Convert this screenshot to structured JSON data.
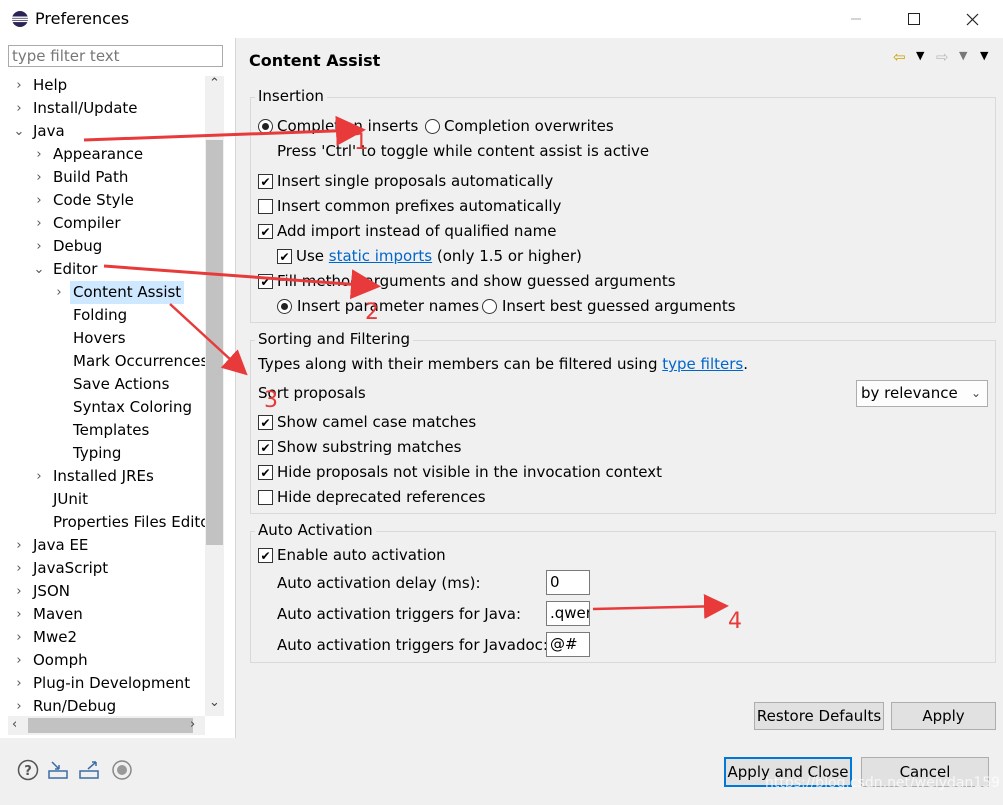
{
  "window": {
    "title": "Preferences"
  },
  "filter": {
    "placeholder": "type filter text"
  },
  "tree": {
    "items": [
      {
        "label": "Help",
        "level": 0,
        "chev": "›"
      },
      {
        "label": "Install/Update",
        "level": 0,
        "chev": "›"
      },
      {
        "label": "Java",
        "level": 0,
        "chev": "⌄"
      },
      {
        "label": "Appearance",
        "level": 1,
        "chev": "›"
      },
      {
        "label": "Build Path",
        "level": 1,
        "chev": "›"
      },
      {
        "label": "Code Style",
        "level": 1,
        "chev": "›"
      },
      {
        "label": "Compiler",
        "level": 1,
        "chev": "›"
      },
      {
        "label": "Debug",
        "level": 1,
        "chev": "›"
      },
      {
        "label": "Editor",
        "level": 1,
        "chev": "⌄"
      },
      {
        "label": "Content Assist",
        "level": 2,
        "chev": "›",
        "selected": true
      },
      {
        "label": "Folding",
        "level": 2,
        "chev": ""
      },
      {
        "label": "Hovers",
        "level": 2,
        "chev": ""
      },
      {
        "label": "Mark Occurrences",
        "level": 2,
        "chev": ""
      },
      {
        "label": "Save Actions",
        "level": 2,
        "chev": ""
      },
      {
        "label": "Syntax Coloring",
        "level": 2,
        "chev": ""
      },
      {
        "label": "Templates",
        "level": 2,
        "chev": ""
      },
      {
        "label": "Typing",
        "level": 2,
        "chev": ""
      },
      {
        "label": "Installed JREs",
        "level": 1,
        "chev": "›"
      },
      {
        "label": "JUnit",
        "level": 1,
        "chev": ""
      },
      {
        "label": "Properties Files Edito",
        "level": 1,
        "chev": ""
      },
      {
        "label": "Java EE",
        "level": 0,
        "chev": "›"
      },
      {
        "label": "JavaScript",
        "level": 0,
        "chev": "›"
      },
      {
        "label": "JSON",
        "level": 0,
        "chev": "›"
      },
      {
        "label": "Maven",
        "level": 0,
        "chev": "›"
      },
      {
        "label": "Mwe2",
        "level": 0,
        "chev": "›"
      },
      {
        "label": "Oomph",
        "level": 0,
        "chev": "›"
      },
      {
        "label": "Plug-in Development",
        "level": 0,
        "chev": "›"
      },
      {
        "label": "Run/Debug",
        "level": 0,
        "chev": "›"
      }
    ]
  },
  "page": {
    "title": "Content Assist"
  },
  "insertion": {
    "group_label": "Insertion",
    "completion_inserts": "Completion inserts",
    "completion_overwrites": "Completion overwrites",
    "toggle_hint": "Press 'Ctrl' to toggle while content assist is active",
    "insert_single": "Insert single proposals automatically",
    "insert_common_prefixes": "Insert common prefixes automatically",
    "add_import": "Add import instead of qualified name",
    "use_prefix": "Use ",
    "static_imports_link": "static imports",
    "static_imports_suffix": " (only 1.5 or higher)",
    "fill_method_args": "Fill method arguments and show guessed arguments",
    "insert_param_names": "Insert parameter names",
    "insert_best_guessed": "Insert best guessed arguments"
  },
  "sorting": {
    "group_label": "Sorting and Filtering",
    "types_text_prefix": "Types along with their members can be filtered using ",
    "type_filters_link": "type filters",
    "types_text_suffix": ".",
    "sort_proposals": "Sort proposals",
    "sort_value": "by relevance",
    "camel_case": "Show camel case matches",
    "substring": "Show substring matches",
    "hide_not_visible": "Hide proposals not visible in the invocation context",
    "hide_deprecated": "Hide deprecated references"
  },
  "auto_activation": {
    "group_label": "Auto Activation",
    "enable": "Enable auto activation",
    "delay_label": "Auto activation delay (ms):",
    "delay_value": "0",
    "java_triggers_label": "Auto activation triggers for Java:",
    "java_triggers_value": ".qwer",
    "javadoc_triggers_label": "Auto activation triggers for Javadoc:",
    "javadoc_triggers_value": "@#"
  },
  "buttons": {
    "restore_defaults": "Restore Defaults",
    "apply": "Apply",
    "apply_close": "Apply and Close",
    "cancel": "Cancel"
  },
  "annotations": {
    "a1": "1",
    "a2": "2",
    "a3": "3",
    "a4": "4"
  },
  "watermark": "https://blog.csdn.net/weiydan159",
  "colors": {
    "annotation": "#e83a3a",
    "selection": "#cde8ff",
    "link": "#0066cc",
    "primary_border": "#0078d7"
  }
}
